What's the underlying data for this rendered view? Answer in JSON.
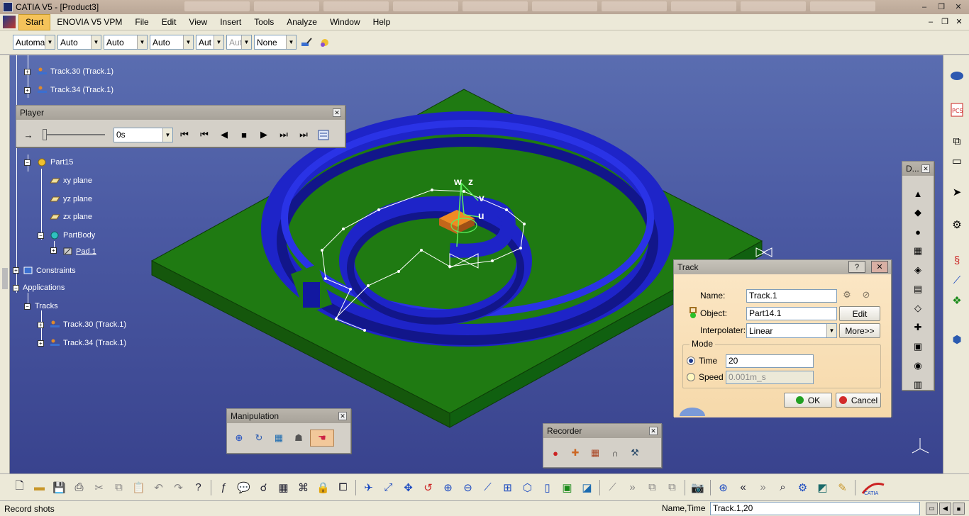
{
  "window": {
    "title": "CATIA V5 - [Product3]",
    "controls": [
      "–",
      "❐",
      "✕"
    ],
    "mdi_controls": [
      "–",
      "❐",
      "✕"
    ]
  },
  "menu": {
    "items": [
      "Start",
      "ENOVIA V5 VPM",
      "File",
      "Edit",
      "View",
      "Insert",
      "Tools",
      "Analyze",
      "Window",
      "Help"
    ],
    "active_index": 0
  },
  "toolbar_combos": [
    {
      "value": "Automa",
      "disabled": false
    },
    {
      "value": "Auto",
      "disabled": false
    },
    {
      "value": "Auto",
      "disabled": false
    },
    {
      "value": "Auto",
      "disabled": false
    },
    {
      "value": "Aut",
      "disabled": false
    },
    {
      "value": "Aut",
      "disabled": true
    },
    {
      "value": "None",
      "disabled": false
    }
  ],
  "toolbar_icons": [
    "paintbrush-icon",
    "magic-wand-icon"
  ],
  "tree": {
    "top_nodes": [
      {
        "label": "Track.30 (Track.1)",
        "icon": "track-icon"
      },
      {
        "label": "Track.34 (Track.1)",
        "icon": "track-icon"
      }
    ],
    "part": {
      "label": "Part15",
      "icon": "part-gear-icon"
    },
    "part_children": [
      {
        "label": "xy plane",
        "icon": "plane-icon"
      },
      {
        "label": "yz plane",
        "icon": "plane-icon"
      },
      {
        "label": "zx plane",
        "icon": "plane-icon"
      },
      {
        "label": "PartBody",
        "icon": "body-icon"
      }
    ],
    "pad": {
      "label": "Pad.1",
      "icon": "pad-icon"
    },
    "constraints": {
      "label": "Constraints",
      "icon": "constraints-icon"
    },
    "applications": {
      "label": "Applications"
    },
    "tracks": {
      "label": "Tracks"
    },
    "track_children": [
      {
        "label": "Track.30 (Track.1)",
        "icon": "track-icon"
      },
      {
        "label": "Track.34 (Track.1)",
        "icon": "track-icon"
      }
    ]
  },
  "player": {
    "title": "Player",
    "time_value": "0s",
    "buttons": [
      "⏮",
      "⏮",
      "◀",
      "■",
      "▶",
      "⏭",
      "⏭"
    ]
  },
  "axis_labels": {
    "w": "w",
    "z": "z",
    "v": "v",
    "u": "u"
  },
  "track_dialog": {
    "title": "Track",
    "help_glyph": "?",
    "name_label": "Name:",
    "name_value": "Track.1",
    "object_label": "Object:",
    "object_value": "Part14.1",
    "edit_label": "Edit",
    "interpolater_label": "Interpolater:",
    "interpolater_value": "Linear",
    "more_label": "More>>",
    "mode_label": "Mode",
    "time_label": "Time",
    "time_value": "20",
    "speed_label": "Speed",
    "speed_value": "0.001m_s",
    "ok_label": "OK",
    "cancel_label": "Cancel",
    "colors": {
      "ok": "#22a022",
      "cancel": "#d22a2a"
    }
  },
  "manipulation": {
    "title": "Manipulation",
    "icons": [
      "manipulate-axis-icon",
      "rotate-snap-icon",
      "compass-box-icon",
      "stacked-parts-icon",
      "hand-icon"
    ]
  },
  "recorder": {
    "title": "Recorder",
    "icons": [
      "record-shot-icon",
      "add-shot-icon",
      "modify-shot-icon",
      "delete-shot-icon",
      "simulation-icon"
    ]
  },
  "d_toolbar": {
    "title": "D...",
    "icons": [
      "simulation-icon",
      "track-icon",
      "sequence-icon",
      "shuttle-icon",
      "swept-volume-icon",
      "replay-icon",
      "clash-icon",
      "distance-icon",
      "sectioning-icon",
      "smooth-icon",
      "video-icon",
      "link-icon"
    ]
  },
  "right_panel_icons": [
    "catia-logo-icon",
    "pcs-icon",
    "apply-icon",
    "screen-icon",
    "arrow-cursor-icon",
    "gear-drop-icon",
    "spring-icon",
    "axis-icon",
    "cube-set-icon",
    "dice-icon"
  ],
  "bottom_icons": [
    "new-icon",
    "open-icon",
    "save-icon",
    "print-icon",
    "cut-icon",
    "copy-icon",
    "paste-icon",
    "undo-icon",
    "redo-icon",
    "whats-this-icon",
    "|",
    "formula-icon",
    "comment-icon",
    "knowledge-icon",
    "table-icon",
    "tree-icon",
    "lock-icon",
    "bracket-icon",
    "|",
    "fly-icon",
    "fit-all-icon",
    "pan-icon",
    "rotate-icon",
    "zoom-in-icon",
    "zoom-out-icon",
    "normal-view-icon",
    "multi-view-icon",
    "iso-view-icon",
    "hide-icon",
    "swap-icon",
    "shading-icon",
    "|",
    "snap-icon",
    "arrows-icon",
    "copy-node-icon",
    "paste-node-icon",
    "|",
    "camera-icon",
    "|",
    "target-icon",
    "collapse-icon",
    "expand-icon",
    "magnifier-icon",
    "filter-icon",
    "render-icon",
    "light-icon",
    "|",
    "catia-logo-icon"
  ],
  "status": {
    "message": "Record shots",
    "cmd_label": "Name,Time",
    "cmd_value": "Track.1,20"
  }
}
